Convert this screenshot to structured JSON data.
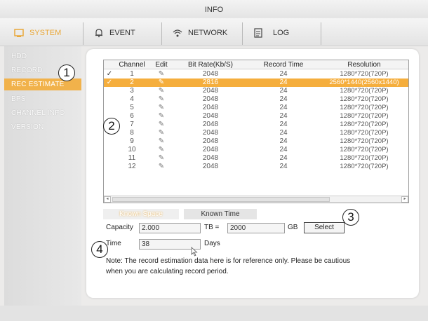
{
  "window": {
    "title": "INFO"
  },
  "tabs": [
    {
      "label": "SYSTEM",
      "icon": "system-icon",
      "active": true
    },
    {
      "label": "EVENT",
      "icon": "bell-icon",
      "active": false
    },
    {
      "label": "NETWORK",
      "icon": "network-icon",
      "active": false
    },
    {
      "label": "LOG",
      "icon": "log-icon",
      "active": false
    }
  ],
  "sidebar": {
    "items": [
      {
        "label": "HDD"
      },
      {
        "label": "RECORD"
      },
      {
        "label": "REC ESTIMATE",
        "active": true
      },
      {
        "label": "BPS"
      },
      {
        "label": "CHANNEL INFO"
      },
      {
        "label": "VERSION"
      }
    ]
  },
  "table": {
    "headers": {
      "channel": "Channel",
      "edit": "Edit",
      "bitrate": "Bit Rate(Kb/S)",
      "record_time": "Record Time",
      "resolution": "Resolution"
    },
    "rows": [
      {
        "checked": true,
        "channel": "1",
        "bitrate": "2048",
        "record_time": "24",
        "resolution": "1280*720(720P)",
        "selected": false
      },
      {
        "checked": true,
        "channel": "2",
        "bitrate": "2816",
        "record_time": "24",
        "resolution": "2560*1440(2560x1440)",
        "selected": true
      },
      {
        "checked": false,
        "channel": "3",
        "bitrate": "2048",
        "record_time": "24",
        "resolution": "1280*720(720P)",
        "selected": false
      },
      {
        "checked": false,
        "channel": "4",
        "bitrate": "2048",
        "record_time": "24",
        "resolution": "1280*720(720P)",
        "selected": false
      },
      {
        "checked": false,
        "channel": "5",
        "bitrate": "2048",
        "record_time": "24",
        "resolution": "1280*720(720P)",
        "selected": false
      },
      {
        "checked": false,
        "channel": "6",
        "bitrate": "2048",
        "record_time": "24",
        "resolution": "1280*720(720P)",
        "selected": false
      },
      {
        "checked": false,
        "channel": "7",
        "bitrate": "2048",
        "record_time": "24",
        "resolution": "1280*720(720P)",
        "selected": false
      },
      {
        "checked": false,
        "channel": "8",
        "bitrate": "2048",
        "record_time": "24",
        "resolution": "1280*720(720P)",
        "selected": false
      },
      {
        "checked": false,
        "channel": "9",
        "bitrate": "2048",
        "record_time": "24",
        "resolution": "1280*720(720P)",
        "selected": false
      },
      {
        "checked": false,
        "channel": "10",
        "bitrate": "2048",
        "record_time": "24",
        "resolution": "1280*720(720P)",
        "selected": false
      },
      {
        "checked": false,
        "channel": "11",
        "bitrate": "2048",
        "record_time": "24",
        "resolution": "1280*720(720P)",
        "selected": false
      },
      {
        "checked": false,
        "channel": "12",
        "bitrate": "2048",
        "record_time": "24",
        "resolution": "1280*720(720P)",
        "selected": false
      }
    ]
  },
  "subtabs": {
    "known_space": "Known Space",
    "known_time": "Known Time"
  },
  "form": {
    "capacity_label": "Capacity",
    "capacity_value": "2.000",
    "tb_label": "TB =",
    "gb_value": "2000",
    "gb_label": "GB",
    "select_label": "Select",
    "time_label": "Time",
    "time_value": "38",
    "days_label": "Days"
  },
  "note": {
    "line1": "Note: The record estimation data here is for reference only. Please be cautious",
    "line2": "when you are calculating record period."
  },
  "callouts": [
    "1",
    "2",
    "3",
    "4"
  ],
  "colors": {
    "accent": "#f5ae3d",
    "panel": "#ffffff",
    "background": "#ecebea"
  }
}
